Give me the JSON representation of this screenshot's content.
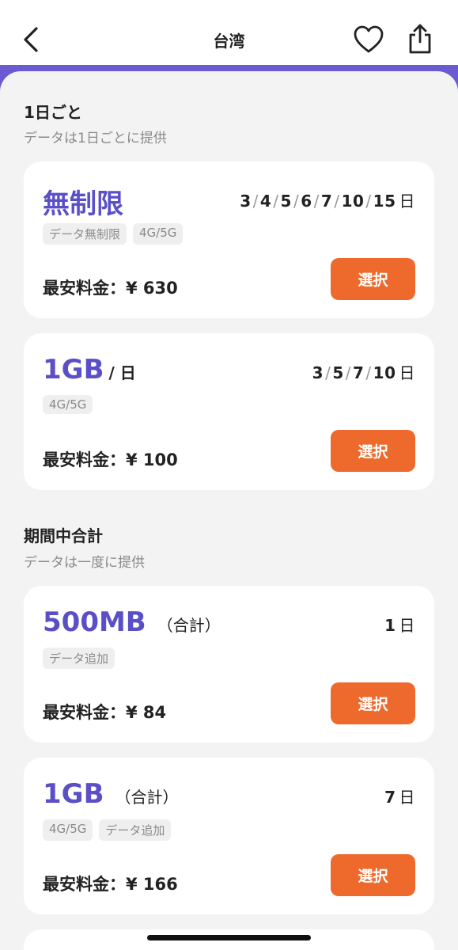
{
  "header": {
    "title": "台湾"
  },
  "sections": [
    {
      "title": "1日ごと",
      "subtitle": "データは1日ごとに提供",
      "plans": [
        {
          "name": "無制限",
          "suffix": "",
          "days": [
            "3",
            "4",
            "5",
            "6",
            "7",
            "10",
            "15"
          ],
          "days_unit": "日",
          "tags": [
            "データ無制限",
            "4G/5G"
          ],
          "price_label": "最安料金：¥ 630",
          "button": "選択"
        },
        {
          "name": "1GB",
          "suffix": "/ 日",
          "days": [
            "3",
            "5",
            "7",
            "10"
          ],
          "days_unit": "日",
          "tags": [
            "4G/5G"
          ],
          "price_label": "最安料金：¥ 100",
          "button": "選択"
        }
      ]
    },
    {
      "title": "期間中合計",
      "subtitle": "データは一度に提供",
      "plans": [
        {
          "name": "500MB",
          "suffix": "（合計）",
          "days": [
            "1"
          ],
          "days_unit": "日",
          "tags": [
            "データ追加"
          ],
          "price_label": "最安料金：¥ 84",
          "button": "選択"
        },
        {
          "name": "1GB",
          "suffix": "（合計）",
          "days": [
            "7"
          ],
          "days_unit": "日",
          "tags": [
            "4G/5G",
            "データ追加"
          ],
          "price_label": "最安料金：¥ 166",
          "button": "選択"
        }
      ]
    }
  ],
  "colors": {
    "accent_purple": "#6b5bd2",
    "plan_name": "#5b4fc8",
    "button_orange": "#ee6a2c",
    "background": "#f3f3f3"
  },
  "icons": {
    "back": "chevron-left-icon",
    "favorite": "heart-icon",
    "share": "share-icon"
  }
}
